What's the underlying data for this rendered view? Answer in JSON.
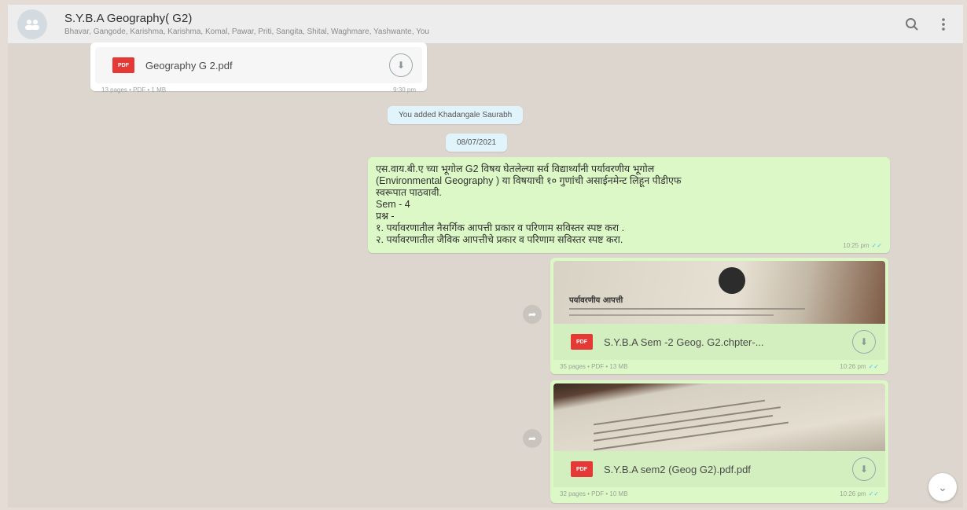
{
  "header": {
    "group_name": "S.Y.B.A Geography( G2)",
    "members": "Bhavar, Gangode, Karishma, Karishma, Komal, Pawar, Priti, Sangita, Shital, Waghmare, Yashwante, You",
    "search_icon": "search-icon",
    "menu_icon": "menu-dots-icon"
  },
  "messages": {
    "doc1": {
      "name": "Geography G 2.pdf",
      "meta": "13 pages • PDF • 1 MB",
      "time": "9:30 pm",
      "badge": "PDF"
    },
    "system_added": "You added Khadangale Saurabh",
    "date_chip": "08/07/2021",
    "text_msg": {
      "body": "एस.वाय.बी.ए च्या भूगोल  G2 विषय घेतलेल्या सर्व विद्यार्थ्यांनी पर्यावरणीय भूगोल\n(Environmental Geography ) या विषयाची १० गुणांची असाईनमेन्ट लिहून पीडीएफ\nस्वरूपात पाठवावी.\nSem - 4\nप्रश्न -\n१. पर्यावरणातील नैसर्गिक आपत्ती प्रकार व परिणाम सविस्तर स्पष्ट करा .\n २. पर्यावरणातील जैविक आपत्तीचे प्रकार व परिणाम सविस्तर स्पष्ट करा.",
      "time": "10:25 pm"
    },
    "doc2": {
      "name": "S.Y.B.A Sem -2 Geog. G2.chpter-...",
      "meta": "35 pages • PDF • 13 MB",
      "time": "10:26 pm",
      "badge": "PDF",
      "thumb_text": "पर्यावरणीय आपत्ती"
    },
    "doc3": {
      "name": "S.Y.B.A sem2 (Geog G2).pdf.pdf",
      "meta": "32 pages • PDF • 10 MB",
      "time": "10:26 pm",
      "badge": "PDF"
    }
  },
  "colors": {
    "incoming": "#ffffff",
    "outgoing": "#dcf8c6",
    "system": "#e1f3fb",
    "pdf": "#e53935"
  }
}
